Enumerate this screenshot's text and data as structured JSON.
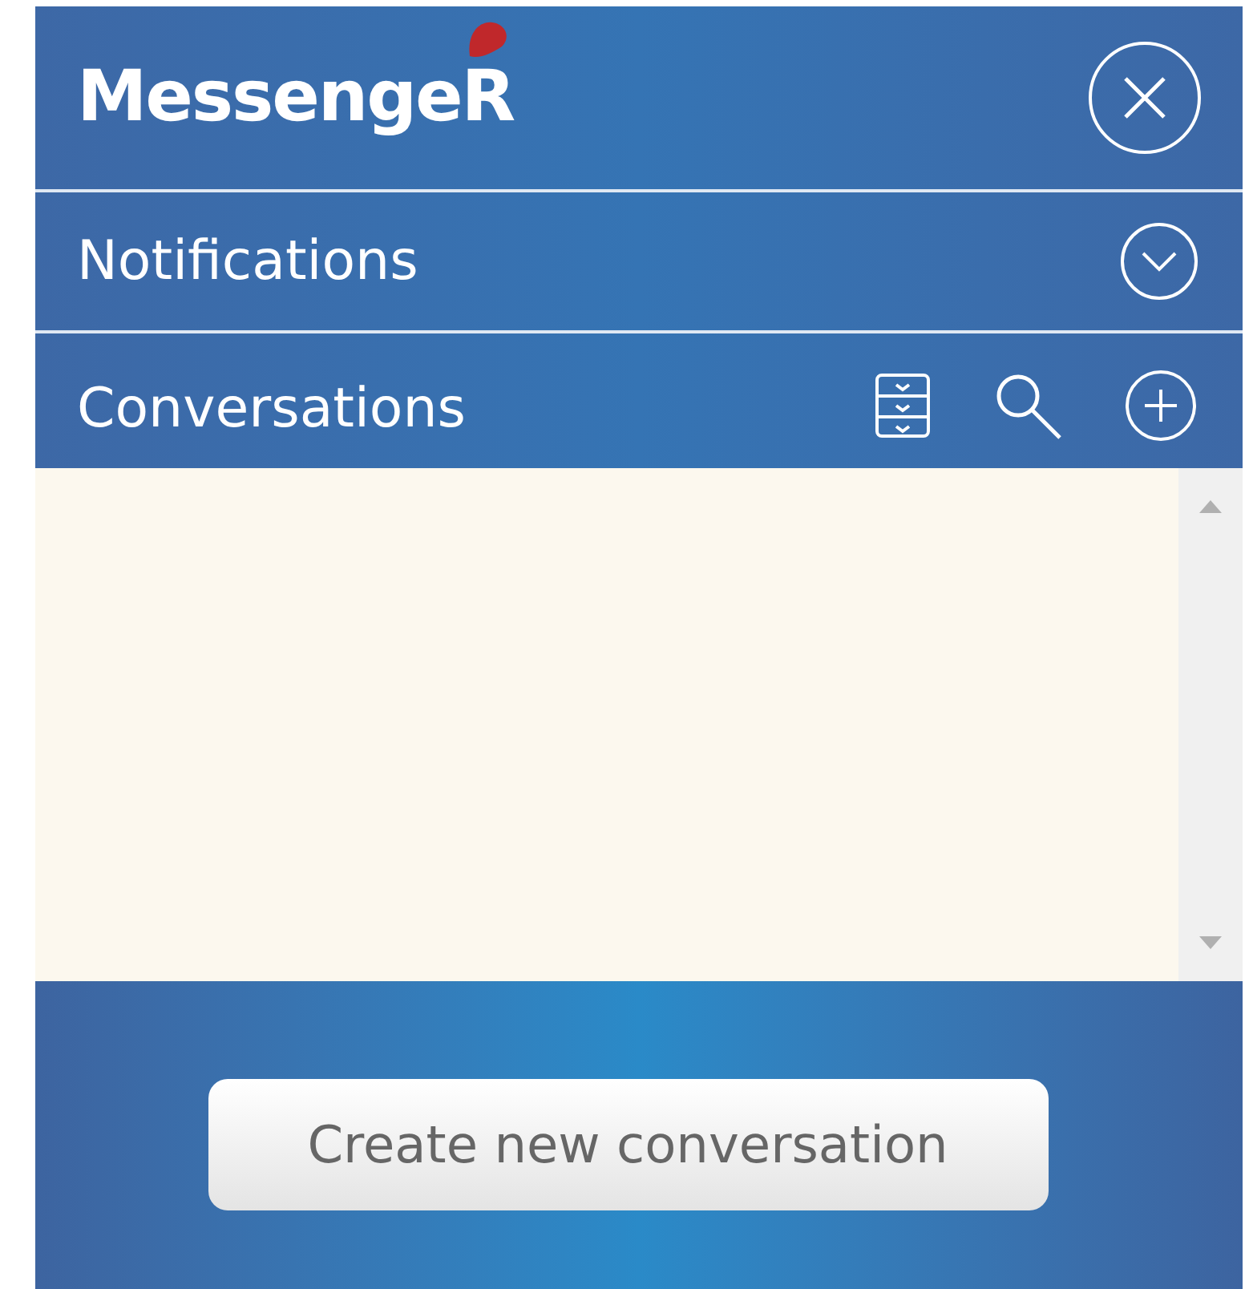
{
  "header": {
    "logo": "MessengeR"
  },
  "notifications": {
    "title": "Notifications",
    "expanded": false
  },
  "conversations": {
    "title": "Conversations"
  },
  "create_button": "Create new conversation"
}
